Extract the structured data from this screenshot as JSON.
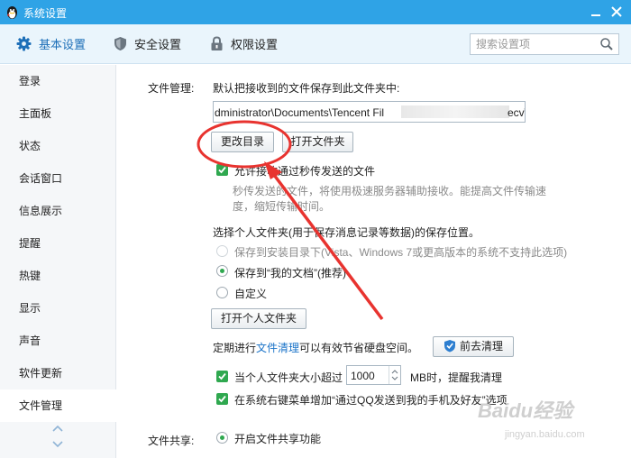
{
  "window": {
    "title": "系统设置"
  },
  "toolbar": {
    "tabs": [
      {
        "label": "基本设置",
        "icon": "gear-icon"
      },
      {
        "label": "安全设置",
        "icon": "shield-icon"
      },
      {
        "label": "权限设置",
        "icon": "lock-icon"
      }
    ],
    "search_placeholder": "搜索设置项"
  },
  "sidebar": {
    "items": [
      "登录",
      "主面板",
      "状态",
      "会话窗口",
      "信息展示",
      "提醒",
      "热键",
      "显示",
      "声音",
      "软件更新",
      "文件管理"
    ],
    "active": "文件管理"
  },
  "file_mgmt": {
    "label": "文件管理:",
    "desc": "默认把接收到的文件保存到此文件夹中:",
    "path_value": "dministrator\\Documents\\Tencent Fil",
    "path_tail": "ecv\\",
    "btn_change": "更改目录",
    "btn_open": "打开文件夹",
    "allow_label": "允许接收通过秒传发送的文件",
    "allow_desc_1": "秒传发送的文件，将使用极速服务器辅助接收。能提高文件传输速",
    "allow_desc_2": "度，缩短传输时间。"
  },
  "personal_folder": {
    "title": "选择个人文件夹(用于保存消息记录等数据)的保存位置。",
    "options": [
      "保存到安装目录下(Vista、Windows 7或更高版本的系统不支持此选项)",
      "保存到“我的文档”(推荐)",
      "自定义"
    ],
    "selected_index": 1,
    "btn_open": "打开个人文件夹"
  },
  "cleanup": {
    "text_before": "定期进行",
    "link": "文件清理",
    "text_after": "可以有效节省硬盘空间。",
    "btn": "前去清理"
  },
  "size_limit": {
    "text_before": "当个人文件夹大小超过",
    "value": "1000",
    "text_after": "MB时，提醒我清理",
    "checked": true
  },
  "context_menu": {
    "label": "在系统右键菜单增加“通过QQ发送到我的手机及好友”选项",
    "checked": true
  },
  "file_share": {
    "label": "文件共享:",
    "option": "开启文件共享功能"
  },
  "watermark": {
    "main": "Baidu经验",
    "sub": "jingyan.baidu.com"
  },
  "colors": {
    "titlebar": "#2fa3e6",
    "accent": "#1d6fb8",
    "check": "#2fa84f",
    "annotation": "#e8332f"
  }
}
